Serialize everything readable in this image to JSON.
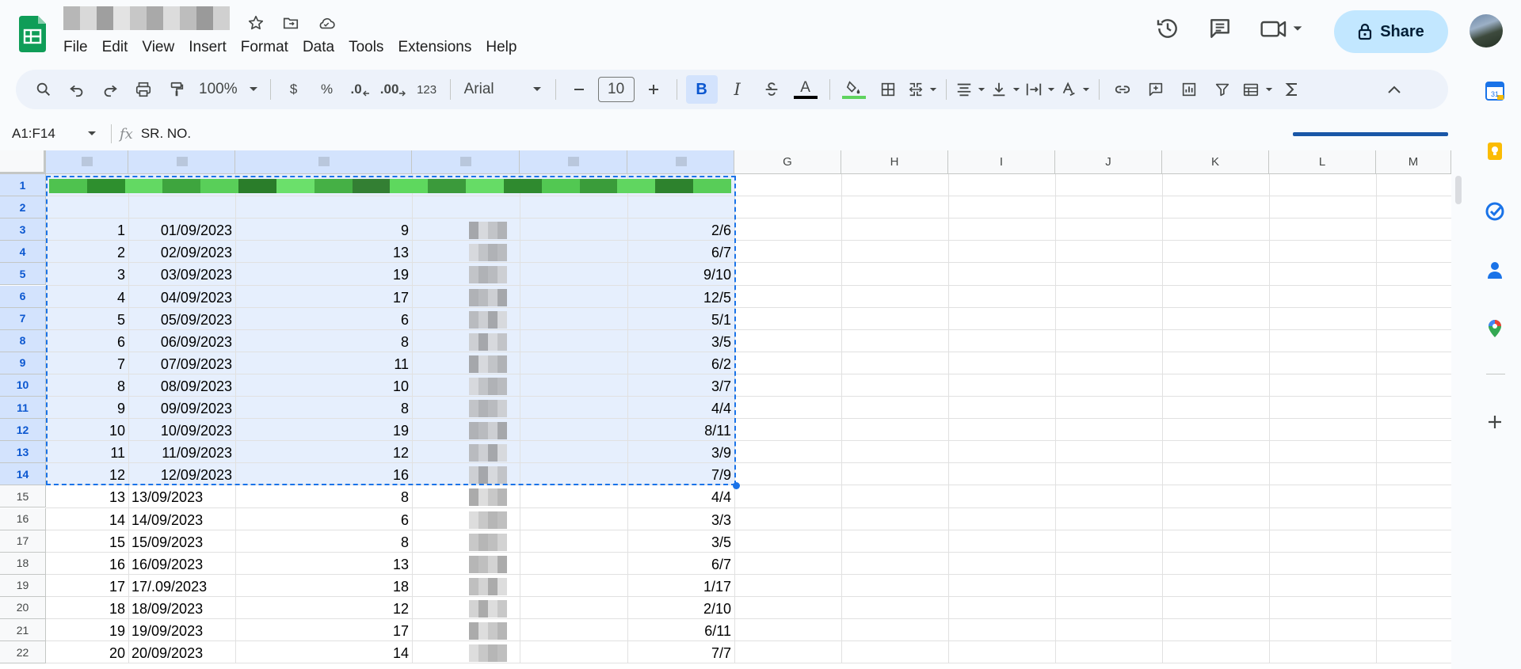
{
  "menu": [
    "File",
    "Edit",
    "View",
    "Insert",
    "Format",
    "Data",
    "Tools",
    "Extensions",
    "Help"
  ],
  "share_label": "Share",
  "toolbar": {
    "zoom": "100%",
    "currency": "$",
    "percent": "%",
    "dec_decrease": ".0",
    "dec_increase": ".00",
    "number_format": "123",
    "font": "Arial",
    "font_size": "10",
    "bold": "B",
    "italic": "I",
    "text_color": "A"
  },
  "formula_bar": {
    "name_box": "A1:F14",
    "fx": "fx",
    "formula": "SR. NO."
  },
  "columns": [
    "A",
    "B",
    "C",
    "D",
    "E",
    "F",
    "G",
    "H",
    "I",
    "J",
    "K",
    "L",
    "M"
  ],
  "rows": [
    "1",
    "2",
    "3",
    "4",
    "5",
    "6",
    "7",
    "8",
    "9",
    "10",
    "11",
    "12",
    "13",
    "14",
    "15",
    "16",
    "17",
    "18",
    "19",
    "20",
    "21",
    "22"
  ],
  "selected_range": "A1:F14",
  "data_rows": [
    {
      "a": "1",
      "b": "01/09/2023",
      "c": "9",
      "f": "2/6"
    },
    {
      "a": "2",
      "b": "02/09/2023",
      "c": "13",
      "f": "6/7"
    },
    {
      "a": "3",
      "b": "03/09/2023",
      "c": "19",
      "f": "9/10"
    },
    {
      "a": "4",
      "b": "04/09/2023",
      "c": "17",
      "f": "12/5"
    },
    {
      "a": "5",
      "b": "05/09/2023",
      "c": "6",
      "f": "5/1"
    },
    {
      "a": "6",
      "b": "06/09/2023",
      "c": "8",
      "f": "3/5"
    },
    {
      "a": "7",
      "b": "07/09/2023",
      "c": "11",
      "f": "6/2"
    },
    {
      "a": "8",
      "b": "08/09/2023",
      "c": "10",
      "f": "3/7"
    },
    {
      "a": "9",
      "b": "09/09/2023",
      "c": "8",
      "f": "4/4"
    },
    {
      "a": "10",
      "b": "10/09/2023",
      "c": "19",
      "f": "8/11"
    },
    {
      "a": "11",
      "b": "11/09/2023",
      "c": "12",
      "f": "3/9"
    },
    {
      "a": "12",
      "b": "12/09/2023",
      "c": "16",
      "f": "7/9"
    },
    {
      "a": "13",
      "b": "13/09/2023",
      "c": "8",
      "f": "4/4"
    },
    {
      "a": "14",
      "b": "14/09/2023",
      "c": "6",
      "f": "3/3"
    },
    {
      "a": "15",
      "b": "15/09/2023",
      "c": "8",
      "f": "3/5"
    },
    {
      "a": "16",
      "b": "16/09/2023",
      "c": "13",
      "f": "6/7"
    },
    {
      "a": "17",
      "b": "17/.09/2023",
      "c": "18",
      "f": "1/17"
    },
    {
      "a": "18",
      "b": "18/09/2023",
      "c": "12",
      "f": "2/10"
    },
    {
      "a": "19",
      "b": "19/09/2023",
      "c": "17",
      "f": "6/11"
    },
    {
      "a": "20",
      "b": "20/09/2023",
      "c": "14",
      "f": "7/7"
    }
  ],
  "colors": {
    "header_band": "#5fd35f",
    "selection": "#1a73e8",
    "share_bg": "#c2e7ff",
    "sheets_green": "#0f9d58"
  },
  "side_icons": [
    "calendar-icon",
    "keep-icon",
    "tasks-icon",
    "contacts-icon",
    "maps-icon",
    "add-icon"
  ]
}
